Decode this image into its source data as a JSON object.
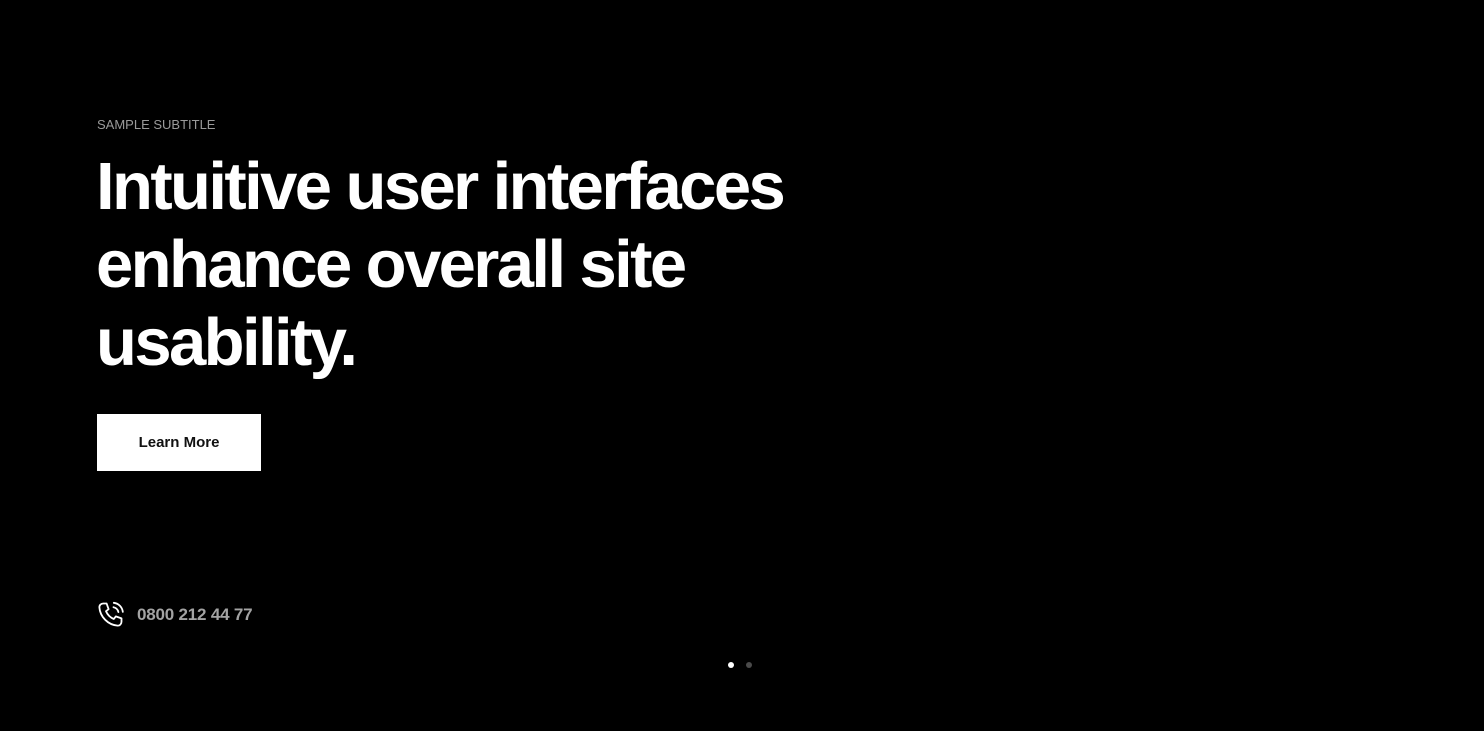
{
  "hero": {
    "subtitle": "SAMPLE SUBTITLE",
    "headline": "Intuitive user interfaces enhance overall site usability.",
    "cta_label": "Learn More"
  },
  "contact": {
    "icon": "phone-icon",
    "phone": "0800 212 44 77"
  },
  "slider": {
    "total_slides": 2,
    "active_slide": 1,
    "active_color": "#ffffff",
    "inactive_color": "#4a4a4a"
  },
  "colors": {
    "background": "#000000",
    "headline": "#ffffff",
    "subtitle": "#9a9a9a",
    "phone_text": "#a3a3a3",
    "button_bg": "#ffffff",
    "button_text": "#111111"
  }
}
